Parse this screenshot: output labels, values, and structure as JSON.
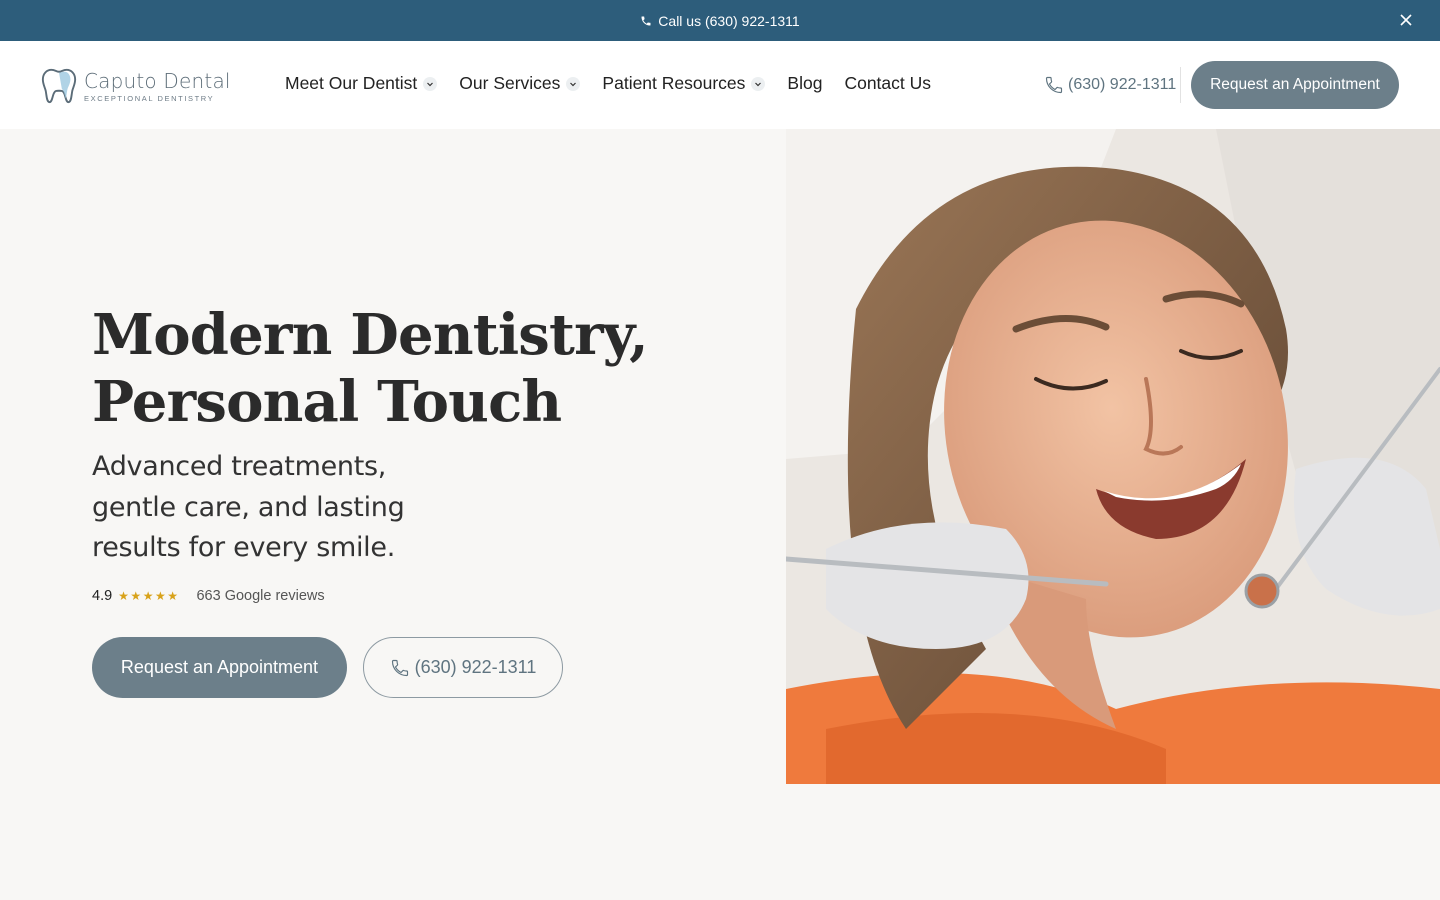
{
  "topbar": {
    "call_text": "Call us (630) 922-1311"
  },
  "logo": {
    "name": "Caputo Dental",
    "tagline": "EXCEPTIONAL DENTISTRY"
  },
  "nav": {
    "items": [
      {
        "label": "Meet Our Dentist",
        "has_dropdown": true
      },
      {
        "label": "Our Services",
        "has_dropdown": true
      },
      {
        "label": "Patient Resources",
        "has_dropdown": true
      },
      {
        "label": "Blog",
        "has_dropdown": false
      },
      {
        "label": "Contact Us",
        "has_dropdown": false
      }
    ]
  },
  "header": {
    "phone": "(630) 922-1311",
    "cta": "Request an Appointment"
  },
  "hero": {
    "title_line1": "Modern Dentistry,",
    "title_line2": "Personal Touch",
    "subtitle": "Advanced treatments, gentle care, and lasting results for every smile.",
    "rating": {
      "score": "4.9",
      "stars": "★★★★★",
      "star_count": 5,
      "reviews": "663 Google reviews"
    },
    "primary_cta": "Request an Appointment",
    "phone_cta": "(630) 922-1311"
  },
  "colors": {
    "topbar": "#2d5d7b",
    "button": "#6c7f8a",
    "star": "#d8a21a",
    "background": "#f8f7f5"
  },
  "icons": [
    "phone-icon",
    "close-icon",
    "tooth-logo-icon",
    "chevron-down-icon"
  ]
}
